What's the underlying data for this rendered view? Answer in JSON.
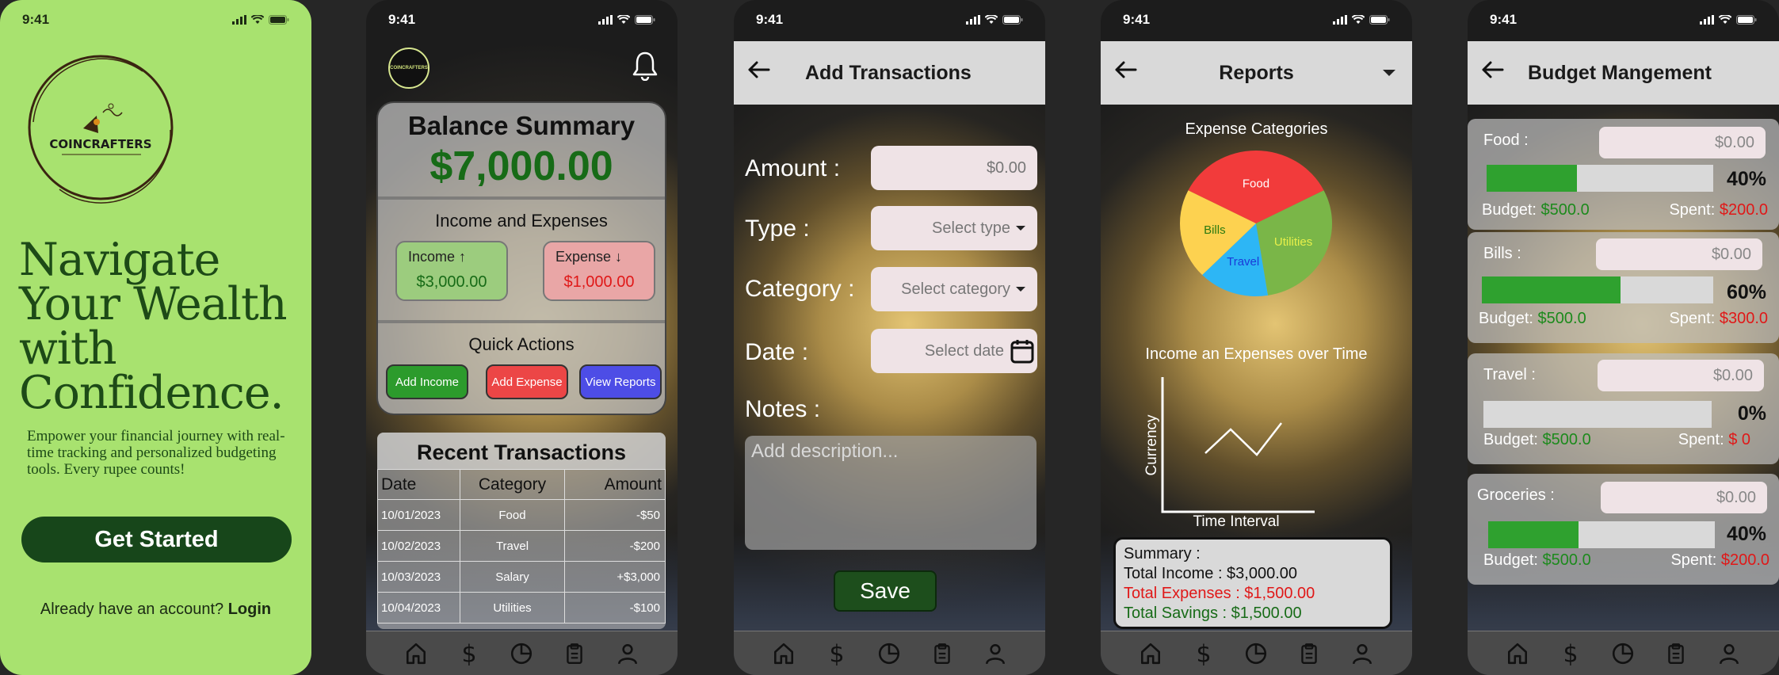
{
  "status_time": "9:41",
  "colors": {
    "green": "#176b17",
    "red": "#e01818",
    "lime": "#a8e26f"
  },
  "onboarding": {
    "logo_text": "COINCRAFTERS",
    "headline": [
      "Navigate",
      "Your Wealth",
      "with",
      "Confidence."
    ],
    "subtitle": "Empower your financial journey with real-time tracking and personalized budgeting tools. Every rupee counts!",
    "cta": "Get Started",
    "login_prompt": "Already have an account? ",
    "login_link": "Login"
  },
  "dashboard": {
    "avatar_text": "COINCRAFTERS",
    "balance_title": "Balance Summary",
    "balance": "$7,000.00",
    "ie_title": "Income and Expenses",
    "income_label": "Income ↑",
    "income_value": "$3,000.00",
    "expense_label": "Expense ↓",
    "expense_value": "$1,000.00",
    "quick_title": "Quick Actions",
    "actions": [
      "Add Income",
      "Add Expense",
      "View Reports"
    ],
    "recent_title": "Recent Transactions",
    "columns": [
      "Date",
      "Category",
      "Amount"
    ],
    "rows": [
      {
        "date": "10/01/2023",
        "category": "Food",
        "amount": "-$50"
      },
      {
        "date": "10/02/2023",
        "category": "Travel",
        "amount": "-$200"
      },
      {
        "date": "10/03/2023",
        "category": "Salary",
        "amount": "+$3,000"
      },
      {
        "date": "10/04/2023",
        "category": "Utilities",
        "amount": "-$100"
      }
    ]
  },
  "add_tx": {
    "title": "Add Transactions",
    "amount_label": "Amount :",
    "amount_value": "$0.00",
    "type_label": "Type :",
    "type_value": "Select type",
    "category_label": "Category :",
    "category_value": "Select category",
    "date_label": "Date :",
    "date_value": "Select date",
    "notes_label": "Notes :",
    "notes_placeholder": "Add description...",
    "save": "Save"
  },
  "reports": {
    "title": "Reports",
    "pie_title": "Expense Categories",
    "pie": [
      {
        "label": "Food",
        "value": 35,
        "color": "#f23b3b"
      },
      {
        "label": "Utilities",
        "value": 30,
        "color": "#7ab648"
      },
      {
        "label": "Travel",
        "value": 15,
        "color": "#2db6f5"
      },
      {
        "label": "Bills",
        "value": 20,
        "color": "#fdd250"
      }
    ],
    "line_title": "Income an Expenses over Time",
    "y_label": "Currency",
    "x_label": "Time Interval",
    "summary_title": "Summary :",
    "summary_income": "Total Income : $3,000.00",
    "summary_expenses": "Total Expenses : $1,500.00",
    "summary_savings": "Total Savings : $1,500.00"
  },
  "budget": {
    "title": "Budget Mangement",
    "items": [
      {
        "name": "Food :",
        "input": "$0.00",
        "percent": "40%",
        "fill": 0.4,
        "budget_label": "Budget: ",
        "budget": "$500.0",
        "spent_label": "Spent: ",
        "spent": "$200.0"
      },
      {
        "name": "Bills :",
        "input": "$0.00",
        "percent": "60%",
        "fill": 0.6,
        "budget_label": "Budget: ",
        "budget": "$500.0",
        "spent_label": "Spent: ",
        "spent": "$300.0"
      },
      {
        "name": "Travel :",
        "input": "$0.00",
        "percent": "0%",
        "fill": 0.0,
        "budget_label": "Budget: ",
        "budget": "$500.0",
        "spent_label": "Spent: ",
        "spent": "$ 0"
      },
      {
        "name": "Groceries :",
        "input": "$0.00",
        "percent": "40%",
        "fill": 0.4,
        "budget_label": "Budget: ",
        "budget": "$500.0",
        "spent_label": "Spent: ",
        "spent": "$200.0"
      }
    ]
  },
  "tabbar_icons": [
    "home-icon",
    "dollar-icon",
    "chart-pie-icon",
    "clipboard-icon",
    "profile-icon"
  ]
}
